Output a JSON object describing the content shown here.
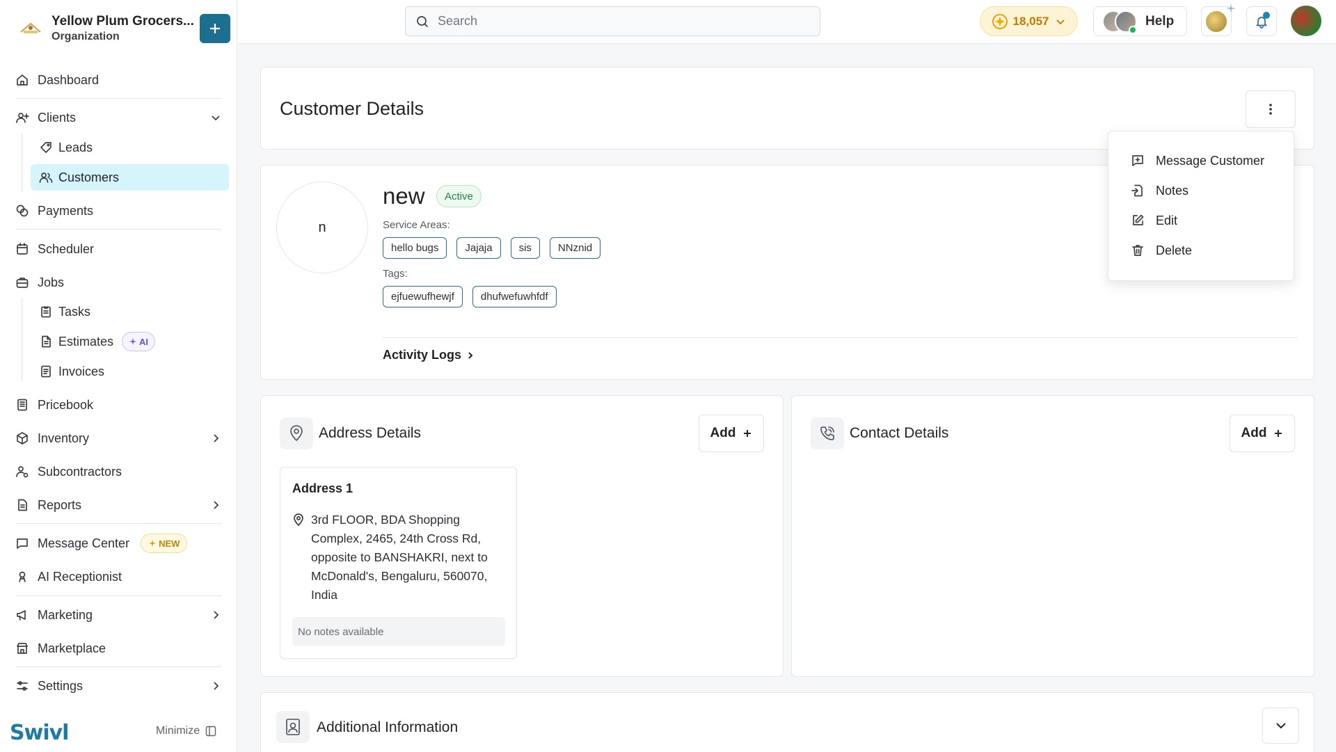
{
  "org": {
    "name": "Yellow Plum Grocers...",
    "type": "Organization"
  },
  "sidebar": {
    "dashboard": "Dashboard",
    "clients": "Clients",
    "leads": "Leads",
    "customers": "Customers",
    "payments": "Payments",
    "scheduler": "Scheduler",
    "jobs": "Jobs",
    "tasks": "Tasks",
    "estimates": "Estimates",
    "estimates_badge": "AI",
    "invoices": "Invoices",
    "pricebook": "Pricebook",
    "inventory": "Inventory",
    "subcontractors": "Subcontractors",
    "reports": "Reports",
    "message_center": "Message Center",
    "message_center_badge": "NEW",
    "ai_receptionist": "AI Receptionist",
    "marketing": "Marketing",
    "marketplace": "Marketplace",
    "settings": "Settings",
    "brand": "Swivl",
    "minimize": "Minimize"
  },
  "topbar": {
    "search_placeholder": "Search",
    "credits": "18,057",
    "help": "Help"
  },
  "page": {
    "title": "Customer Details"
  },
  "customer": {
    "initial": "n",
    "name": "new",
    "status": "Active",
    "service_areas_label": "Service Areas:",
    "service_areas": [
      "hello bugs",
      "Jajaja",
      "sis",
      "NNznid"
    ],
    "tags_label": "Tags:",
    "tags": [
      "ejfuewufhewjf",
      "dhufwefuwhfdf"
    ],
    "activity_logs": "Activity Logs"
  },
  "address_section": {
    "title": "Address Details",
    "add_label": "Add",
    "address_title": "Address 1",
    "address_text": "3rd FLOOR, BDA Shopping Complex, 2465, 24th Cross Rd, opposite to BANSHAKRI, next to McDonald's, Bengaluru, 560070, India",
    "notes": "No notes available"
  },
  "contact_section": {
    "title": "Contact Details",
    "add_label": "Add"
  },
  "additional_section": {
    "title": "Additional Information"
  },
  "menu": {
    "items": [
      "Message Customer",
      "Notes",
      "Edit",
      "Delete"
    ]
  },
  "colors": {
    "accent": "#1d6f8f",
    "active_bg": "#d6f4fb",
    "status_green": "#1e8a3d",
    "credits": "#c07a00"
  },
  "icons": [
    "home-icon",
    "user-plus-icon",
    "tag-icon",
    "users-icon",
    "coins-icon",
    "calendar-icon",
    "briefcase-icon",
    "clipboard-icon",
    "file-icon",
    "receipt-icon",
    "book-icon",
    "box-icon",
    "user-network-icon",
    "report-icon",
    "message-icon",
    "receptionist-icon",
    "megaphone-icon",
    "store-icon",
    "sliders-icon",
    "search-icon",
    "bell-icon",
    "kebab-icon",
    "map-pin-icon",
    "phone-icon",
    "id-card-icon",
    "chevron-down-icon"
  ]
}
